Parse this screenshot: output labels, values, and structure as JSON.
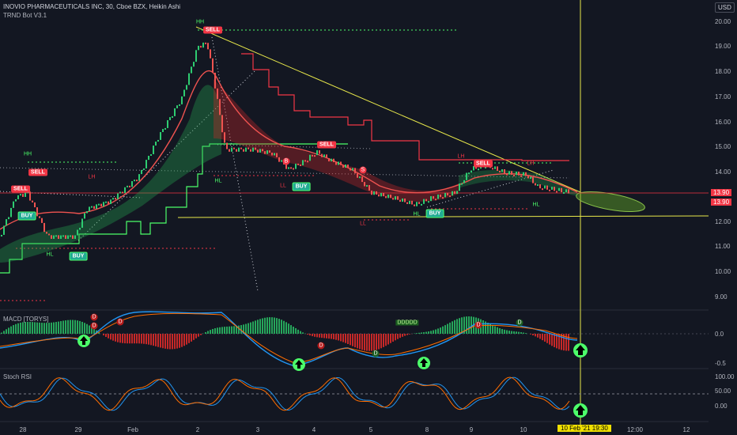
{
  "header": {
    "symbol_title": "INOVIO PHARMACEUTICALS INC, 30, Cboe BZX, Heikin Ashi",
    "indicator": "TRND Bot V3.1",
    "currency": "USD"
  },
  "price_axis": {
    "ticks": [
      "20.00",
      "19.00",
      "18.00",
      "17.00",
      "16.00",
      "15.00",
      "14.00",
      "13.00",
      "12.00",
      "11.00",
      "10.00",
      "9.00"
    ],
    "last_price": "13.90",
    "last_price_2": "13.90"
  },
  "macd_axis": {
    "ticks": [
      "0.0",
      "-0.5"
    ]
  },
  "rsi_axis": {
    "ticks": [
      "100.00",
      "50.00",
      "0.00"
    ]
  },
  "time_axis": {
    "ticks": [
      "28",
      "29",
      "Feb",
      "2",
      "3",
      "4",
      "5",
      "8",
      "9",
      "10",
      "12:00",
      "12"
    ],
    "cursor_label": "10 Feb '21   19:30"
  },
  "panes": {
    "macd_title": "MACD [TORYS]",
    "rsi_title": "Stoch RSI"
  },
  "signals": {
    "sell": "SELL",
    "buy": "BUY",
    "hh": "HH",
    "lh": "LH",
    "ll": "LL",
    "hl": "HL",
    "b": "B",
    "s": "S",
    "d": "D",
    "ddddd": "DDDDD"
  },
  "colors": {
    "bull": "#26a69a",
    "bear": "#ef5350",
    "green": "#4cff6a",
    "red": "#f23645",
    "yellow": "#e8e84a",
    "macd": "#2196f3",
    "signal": "#ff6d00"
  }
}
